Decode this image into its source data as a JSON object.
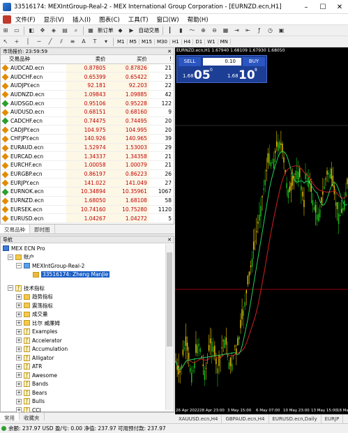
{
  "title": "33516174: MEXIntGroup-Real-2 - MEX International Group Corporation - [EURNZD.ecn,H1]",
  "menu": [
    "文件(F)",
    "显示(V)",
    "插入(I)",
    "图表(C)",
    "工具(T)",
    "窗口(W)",
    "帮助(H)"
  ],
  "toolbar": {
    "new_order": "新订单",
    "autotrading": "自动交易",
    "timeframes": [
      "M1",
      "M5",
      "M15",
      "M30",
      "H1",
      "H4",
      "D1",
      "W1",
      "MN"
    ]
  },
  "market_watch": {
    "header": "市场报价: 23:59:59",
    "columns": [
      "交易品种",
      "卖价",
      "买价",
      "!"
    ],
    "rows": [
      {
        "sym": "AUDCAD.ecn",
        "bid": "0.87805",
        "ask": "0.87826",
        "spread": "21",
        "dir": "up"
      },
      {
        "sym": "AUDCHF.ecn",
        "bid": "0.65399",
        "ask": "0.65422",
        "spread": "23",
        "dir": "up"
      },
      {
        "sym": "AUDJPY.ecn",
        "bid": "92.181",
        "ask": "92.203",
        "spread": "22",
        "dir": "up"
      },
      {
        "sym": "AUDNZD.ecn",
        "bid": "1.09843",
        "ask": "1.09885",
        "spread": "42",
        "dir": "up"
      },
      {
        "sym": "AUDSGD.ecn",
        "bid": "0.95106",
        "ask": "0.95228",
        "spread": "122",
        "dir": "down"
      },
      {
        "sym": "AUDUSD.ecn",
        "bid": "0.68151",
        "ask": "0.68160",
        "spread": "9",
        "dir": "up"
      },
      {
        "sym": "CADCHF.ecn",
        "bid": "0.74475",
        "ask": "0.74495",
        "spread": "20",
        "dir": "down"
      },
      {
        "sym": "CADJPY.ecn",
        "bid": "104.975",
        "ask": "104.995",
        "spread": "20",
        "dir": "up"
      },
      {
        "sym": "CHFJPY.ecn",
        "bid": "140.926",
        "ask": "140.965",
        "spread": "39",
        "dir": "up"
      },
      {
        "sym": "EURAUD.ecn",
        "bid": "1.52974",
        "ask": "1.53003",
        "spread": "29",
        "dir": "up"
      },
      {
        "sym": "EURCAD.ecn",
        "bid": "1.34337",
        "ask": "1.34358",
        "spread": "21",
        "dir": "up"
      },
      {
        "sym": "EURCHF.ecn",
        "bid": "1.00058",
        "ask": "1.00079",
        "spread": "21",
        "dir": "up"
      },
      {
        "sym": "EURGBP.ecn",
        "bid": "0.86197",
        "ask": "0.86223",
        "spread": "26",
        "dir": "up"
      },
      {
        "sym": "EURJPY.ecn",
        "bid": "141.022",
        "ask": "141.049",
        "spread": "27",
        "dir": "up"
      },
      {
        "sym": "EURNOK.ecn",
        "bid": "10.34894",
        "ask": "10.35961",
        "spread": "1067",
        "dir": "down"
      },
      {
        "sym": "EURNZD.ecn",
        "bid": "1.68050",
        "ask": "1.68108",
        "spread": "58",
        "dir": "up"
      },
      {
        "sym": "EURSEK.ecn",
        "bid": "10.74160",
        "ask": "10.75280",
        "spread": "1120",
        "dir": "up"
      },
      {
        "sym": "EURUSD.ecn",
        "bid": "1.04267",
        "ask": "1.04272",
        "spread": "5",
        "dir": "up"
      }
    ],
    "tabs": [
      "交易品种",
      "即时图"
    ]
  },
  "navigator": {
    "header": "导航",
    "root": "MEX ECN Pro",
    "accounts": "账户",
    "server": "MEXIntGroup-Real-2",
    "account": "33516174: Zheng ManJie",
    "indicators": "技术指标",
    "groups": [
      "趋势指标",
      "震荡指标",
      "成交量",
      "比尔 威廉姆"
    ],
    "items": [
      "Examples",
      "Accelerator",
      "Accumulation",
      "Alligator",
      "ATR",
      "Awesome",
      "Bands",
      "Bears",
      "Bulls",
      "CCI"
    ],
    "tabs": [
      "常用",
      "收藏夹"
    ]
  },
  "chart": {
    "info": "EURNZD.ecn,H1  1.67940 1.68109 1.67930 1.68050",
    "sell": "SELL",
    "buy": "BUY",
    "volume": "0.10",
    "sell_small": "1.68",
    "sell_big": "05",
    "sell_sup": "0",
    "buy_small": "1.68",
    "buy_big": "10",
    "buy_sup": "8",
    "xlabels": [
      "26 Apr 2022",
      "28 Apr 23:00",
      "3 May 15:00",
      "6 May 07:00",
      "10 May 23:00",
      "13 May 15:00",
      "18 Ma"
    ],
    "tabs": [
      "XAUUSD.ecn,H4",
      "GBPAUD.ecn,H4",
      "EURUSD.ecn,Daily",
      "EURJP"
    ]
  },
  "status": "余额: 237.97 USD  盈/亏: 0.00  净值: 237.97  可用预付款: 237.97"
}
